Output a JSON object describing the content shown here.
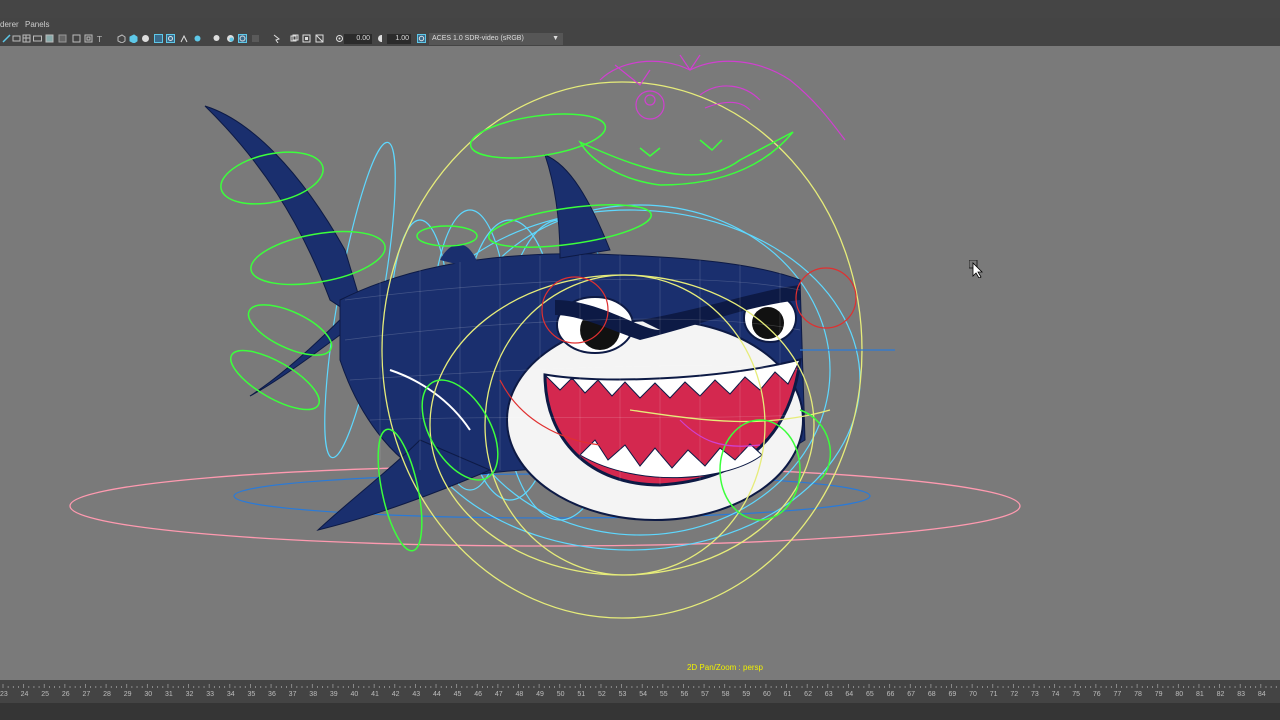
{
  "menubar": {
    "renderer": "derer",
    "panels": "Panels"
  },
  "toolbar": {
    "exposure_value": "0.00",
    "gamma_value": "1.00",
    "color_space": "ACES 1.0 SDR-video (sRGB)"
  },
  "viewport": {
    "hud_text": "2D Pan/Zoom : persp"
  },
  "timeline": {
    "frames": [
      "23",
      "24",
      "25",
      "26",
      "27",
      "28",
      "29",
      "30",
      "31",
      "32",
      "33",
      "34",
      "35",
      "36",
      "37",
      "38",
      "39",
      "40",
      "41",
      "42",
      "43",
      "44",
      "45",
      "46",
      "47",
      "48",
      "49",
      "50",
      "51",
      "52",
      "53",
      "54",
      "55",
      "56",
      "57",
      "58",
      "59",
      "60",
      "61",
      "62",
      "63",
      "64",
      "65",
      "66",
      "67",
      "68",
      "69",
      "70",
      "71",
      "72",
      "73",
      "74",
      "75",
      "76",
      "77",
      "78",
      "79",
      "80",
      "81",
      "82",
      "83",
      "84"
    ]
  },
  "colors": {
    "background": "#7a7a7a",
    "shark_body": "#1a2f6e",
    "mouth_red": "#d4284f",
    "control_green": "#3cff3c",
    "control_cyan": "#5ed8ff",
    "control_yellow": "#e6ec7a",
    "control_pink": "#ff9ab0",
    "control_magenta": "#d040d0",
    "control_red": "#e03030",
    "hud_yellow": "#f0f000"
  }
}
